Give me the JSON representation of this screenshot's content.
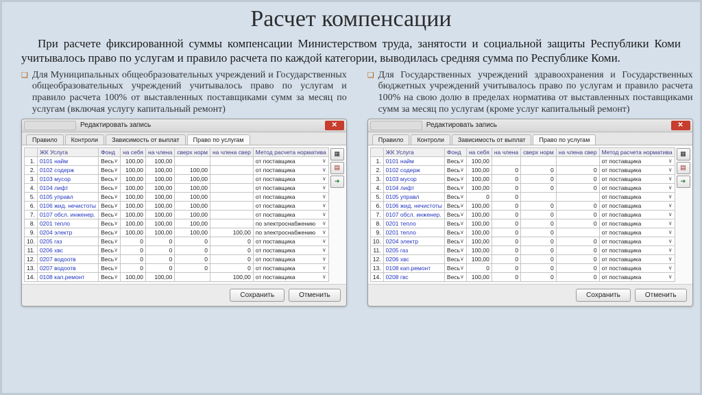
{
  "title": "Расчет компенсации",
  "lead": "При расчете фиксированной суммы компенсации Министерством труда, занятости и социальной защиты Республики Коми учитывалось право по услугам и правило расчета по каждой категории, выводилась средняя сумма по Республике Коми.",
  "left_text": "Для Муниципальных общеобразовательных учреждений и Государственных общеобразовательных учреждений учитывалось право по услугам и правило расчета 100% от выставленных поставщиками сумм за месяц по услугам (включая услугу капитальный ремонт)",
  "right_text": "Для Государственных учреждений здравоохранения и Государственных бюджетных учреждений учитывалось право по услугам и правило расчета 100% на свою долю в пределах норматива от выставленных поставщиками сумм за месяц по услугам (кроме услуг капитальный ремонт)",
  "window_title": "Редактировать запись",
  "tabs": [
    "Правило",
    "Контроли",
    "Зависимость от выплат",
    "Право по услугам"
  ],
  "active_tab": 3,
  "columns": [
    "",
    "ЖК Услуга",
    "Фонд",
    "на себя",
    "на члена",
    "сверх норм",
    "на члена свер",
    "Метод расчета норматива"
  ],
  "buttons": {
    "save": "Сохранить",
    "cancel": "Отменить"
  },
  "rows_left": [
    {
      "n": "1",
      "s": "0101 найм",
      "f": "Весь",
      "a": "100,00",
      "b": "100,00",
      "c": "",
      "d": "",
      "m": "от поставщика"
    },
    {
      "n": "2",
      "s": "0102 содерж",
      "f": "Весь",
      "a": "100,00",
      "b": "100,00",
      "c": "100,00",
      "d": "",
      "m": "от поставщика"
    },
    {
      "n": "3",
      "s": "0103 мусор",
      "f": "Весь",
      "a": "100,00",
      "b": "100,00",
      "c": "100,00",
      "d": "",
      "m": "от поставщика"
    },
    {
      "n": "4",
      "s": "0104 лифт",
      "f": "Весь",
      "a": "100,00",
      "b": "100,00",
      "c": "100,00",
      "d": "",
      "m": "от поставщика"
    },
    {
      "n": "5",
      "s": "0105 управл",
      "f": "Весь",
      "a": "100,00",
      "b": "100,00",
      "c": "100,00",
      "d": "",
      "m": "от поставщика"
    },
    {
      "n": "6",
      "s": "0106 жид. нечистоты",
      "f": "Весь",
      "a": "100,00",
      "b": "100,00",
      "c": "100,00",
      "d": "",
      "m": "от поставщика"
    },
    {
      "n": "7",
      "s": "0107 обсл. инженер.",
      "f": "Весь",
      "a": "100,00",
      "b": "100,00",
      "c": "100,00",
      "d": "",
      "m": "от поставщика"
    },
    {
      "n": "8",
      "s": "0201 тепло",
      "f": "Весь",
      "a": "100,00",
      "b": "100,00",
      "c": "100,00",
      "d": "",
      "m": "по электроснабжению"
    },
    {
      "n": "9",
      "s": "0204 электр",
      "f": "Весь",
      "a": "100,00",
      "b": "100,00",
      "c": "100,00",
      "d": "100,00",
      "m": "по электроснабжению"
    },
    {
      "n": "10",
      "s": "0205 газ",
      "f": "Весь",
      "a": "0",
      "b": "0",
      "c": "0",
      "d": "0",
      "m": "от поставщика"
    },
    {
      "n": "11",
      "s": "0206 хвс",
      "f": "Весь",
      "a": "0",
      "b": "0",
      "c": "0",
      "d": "0",
      "m": "от поставщика"
    },
    {
      "n": "12",
      "s": "0207 водоотв",
      "f": "Весь",
      "a": "0",
      "b": "0",
      "c": "0",
      "d": "0",
      "m": "от поставщика"
    },
    {
      "n": "13",
      "s": "0207 водоотв",
      "f": "Весь",
      "a": "0",
      "b": "0",
      "c": "0",
      "d": "0",
      "m": "от поставщика"
    },
    {
      "n": "14",
      "s": "0108 кап.ремонт",
      "f": "Весь",
      "a": "100,00",
      "b": "100,00",
      "c": "",
      "d": "100,00",
      "m": "от поставщика"
    }
  ],
  "rows_right": [
    {
      "n": "1",
      "s": "0101 найм",
      "f": "Весь",
      "a": "100,00",
      "b": "",
      "c": "",
      "d": "",
      "m": "от поставщика"
    },
    {
      "n": "2",
      "s": "0102 содерж",
      "f": "Весь",
      "a": "100,00",
      "b": "0",
      "c": "0",
      "d": "0",
      "m": "от поставщика"
    },
    {
      "n": "3",
      "s": "0103 мусор",
      "f": "Весь",
      "a": "100,00",
      "b": "0",
      "c": "0",
      "d": "0",
      "m": "от поставщика"
    },
    {
      "n": "4",
      "s": "0104 лифт",
      "f": "Весь",
      "a": "100,00",
      "b": "0",
      "c": "0",
      "d": "0",
      "m": "от поставщика"
    },
    {
      "n": "5",
      "s": "0105 управл",
      "f": "Весь",
      "a": "0",
      "b": "0",
      "c": "",
      "d": "",
      "m": "от поставщика"
    },
    {
      "n": "6",
      "s": "0106 жид. нечистоты",
      "f": "Весь",
      "a": "100,00",
      "b": "0",
      "c": "0",
      "d": "0",
      "m": "от поставщика"
    },
    {
      "n": "7",
      "s": "0107 обсл. инженер.",
      "f": "Весь",
      "a": "100,00",
      "b": "0",
      "c": "0",
      "d": "0",
      "m": "от поставщика"
    },
    {
      "n": "8",
      "s": "0201 тепло",
      "f": "Весь",
      "a": "100,00",
      "b": "0",
      "c": "0",
      "d": "0",
      "m": "от поставщика"
    },
    {
      "n": "9",
      "s": "0201 тепло",
      "f": "Весь",
      "a": "100,00",
      "b": "0",
      "c": "0",
      "d": "",
      "m": "от поставщика"
    },
    {
      "n": "10",
      "s": "0204 электр",
      "f": "Весь",
      "a": "100,00",
      "b": "0",
      "c": "0",
      "d": "0",
      "m": "от поставщика"
    },
    {
      "n": "11",
      "s": "0205 газ",
      "f": "Весь",
      "a": "100,00",
      "b": "0",
      "c": "0",
      "d": "0",
      "m": "от поставщика"
    },
    {
      "n": "12",
      "s": "0206 хвс",
      "f": "Весь",
      "a": "100,00",
      "b": "0",
      "c": "0",
      "d": "0",
      "m": "от поставщика"
    },
    {
      "n": "13",
      "s": "0108 кап.ремонт",
      "f": "Весь",
      "a": "0",
      "b": "0",
      "c": "0",
      "d": "0",
      "m": "от поставщика"
    },
    {
      "n": "14",
      "s": "0208 гвс",
      "f": "Весь",
      "a": "100,00",
      "b": "0",
      "c": "0",
      "d": "0",
      "m": "от поставщика"
    }
  ]
}
